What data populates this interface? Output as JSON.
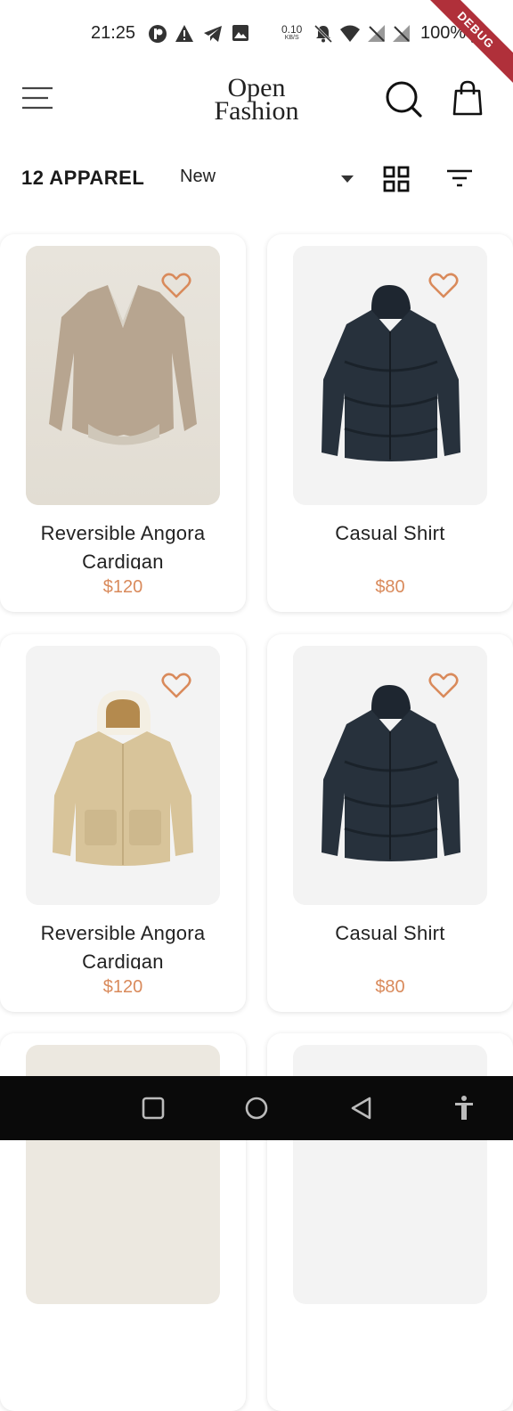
{
  "status": {
    "time": "21:25",
    "net_speed_value": "0.10",
    "net_speed_unit": "KB/S",
    "battery": "100%",
    "debug": "DEBUG"
  },
  "header": {
    "logo_line1": "Open",
    "logo_line2": "Fashion"
  },
  "toolbar": {
    "count_label": "12 APPAREL",
    "sort_value": "New"
  },
  "products": [
    {
      "name": "Reversible Angora Cardigan",
      "price": "$120",
      "image": "beige-cardigan"
    },
    {
      "name": "Casual Shirt",
      "price": "$80",
      "image": "navy-puffer-jacket"
    },
    {
      "name": "Reversible Angora Cardigan",
      "price": "$120",
      "image": "beige-puffer-jacket"
    },
    {
      "name": "Casual Shirt",
      "price": "$80",
      "image": "navy-puffer-jacket"
    }
  ],
  "colors": {
    "accent": "#d98a5b",
    "card_bg": "#ffffff",
    "image_bg": "#f3f3f3",
    "nav_bar": "#0a0a0a",
    "debug_ribbon": "#b0303a"
  },
  "icons": {
    "menu": "menu-icon",
    "search": "search-icon",
    "bag": "shopping-bag-icon",
    "grid": "grid-view-icon",
    "filter": "filter-icon",
    "favorite": "heart-outline-icon",
    "nav_recents": "square-icon",
    "nav_home": "circle-icon",
    "nav_back": "back-triangle-icon",
    "nav_accessibility": "accessibility-icon"
  }
}
